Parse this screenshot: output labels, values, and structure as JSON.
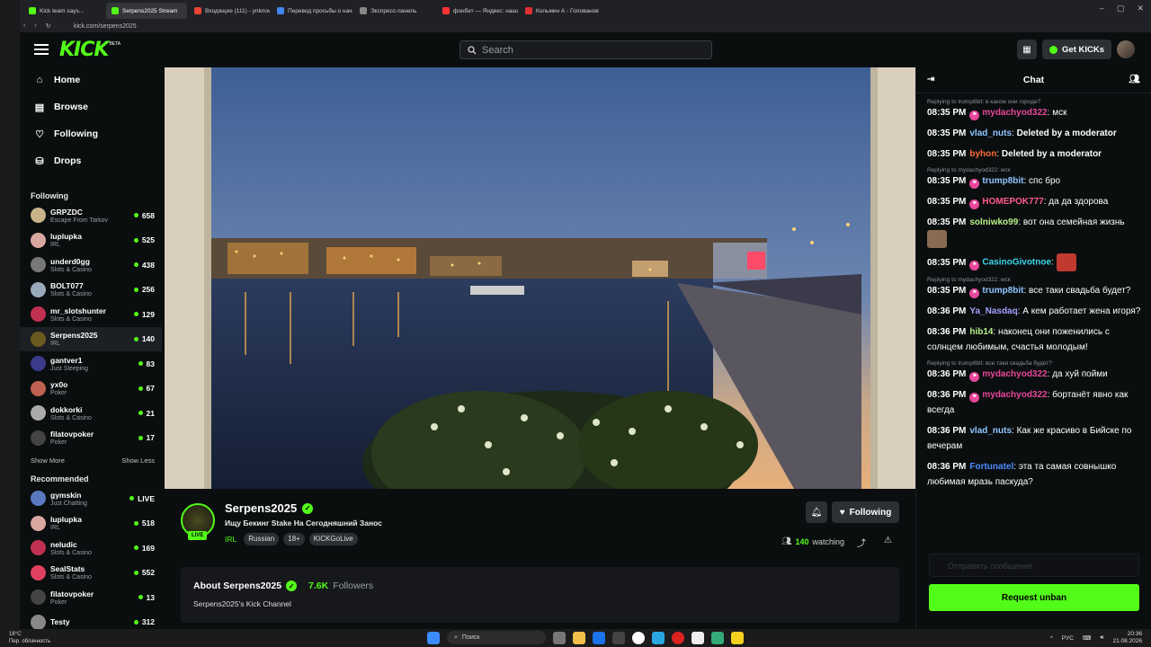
{
  "browser": {
    "tabs": [
      {
        "label": "Kick team says...",
        "color": "#53fc18",
        "active": false
      },
      {
        "label": "Serpens2025 Stream",
        "color": "#53fc18",
        "active": true
      },
      {
        "label": "Входящие (111) - уnknown",
        "color": "#ea4335",
        "active": false
      },
      {
        "label": "Перевод просьбы о нача",
        "color": "#4285f4",
        "active": false
      },
      {
        "label": "Экспресс-панель",
        "color": "#888888",
        "active": false
      },
      {
        "label": "фонбет — Яндекс: нашло",
        "color": "#ff3333",
        "active": false
      },
      {
        "label": "Кольмин А - Голованов Г",
        "color": "#e03030",
        "active": false
      }
    ],
    "url": "kick.com/serpens2025"
  },
  "header": {
    "logo": "KICK",
    "logo_badge": "BETA",
    "search_placeholder": "Search",
    "get_kicks": "Get KICKs"
  },
  "sidebar": {
    "nav": [
      {
        "label": "Home",
        "icon": "home-icon",
        "glyph": "⌂"
      },
      {
        "label": "Browse",
        "icon": "browse-icon",
        "glyph": "▤"
      },
      {
        "label": "Following",
        "icon": "heart-icon",
        "glyph": "♡"
      },
      {
        "label": "Drops",
        "icon": "drops-icon",
        "glyph": "⛁"
      }
    ],
    "following_title": "Following",
    "following": [
      {
        "name": "GRPZDC",
        "cat": "Escape From Tarkov",
        "viewers": "658",
        "color": "#c9b48a"
      },
      {
        "name": "luplupka",
        "cat": "IRL",
        "viewers": "525",
        "color": "#d8a8a0"
      },
      {
        "name": "underd0gg",
        "cat": "Slots & Casino",
        "viewers": "438",
        "color": "#777"
      },
      {
        "name": "BOLT077",
        "cat": "Slots & Casino",
        "viewers": "256",
        "color": "#9ab"
      },
      {
        "name": "mr_slotshunter",
        "cat": "Slots & Casino",
        "viewers": "129",
        "color": "#c03050"
      },
      {
        "name": "Serpens2025",
        "cat": "IRL",
        "viewers": "140",
        "color": "#6a5a20"
      },
      {
        "name": "gantver1",
        "cat": "Just Sleeping",
        "viewers": "83",
        "color": "#3a3a8a"
      },
      {
        "name": "yx0o",
        "cat": "Poker",
        "viewers": "67",
        "color": "#c06050"
      },
      {
        "name": "dokkorki",
        "cat": "Slots & Casino",
        "viewers": "21",
        "color": "#aaa"
      },
      {
        "name": "filatovpoker",
        "cat": "Poker",
        "viewers": "17",
        "color": "#444"
      }
    ],
    "show_more": "Show More",
    "show_less": "Show Less",
    "recommended_title": "Recommended",
    "recommended": [
      {
        "name": "gymskin",
        "cat": "Just Chatting",
        "viewers": "LIVE",
        "color": "#5a7ac0"
      },
      {
        "name": "luplupka",
        "cat": "IRL",
        "viewers": "518",
        "color": "#d8a8a0"
      },
      {
        "name": "neludic",
        "cat": "Slots & Casino",
        "viewers": "169",
        "color": "#c03050"
      },
      {
        "name": "SealStats",
        "cat": "Slots & Casino",
        "viewers": "552",
        "color": "#e04060"
      },
      {
        "name": "filatovpoker",
        "cat": "Poker",
        "viewers": "13",
        "color": "#444"
      },
      {
        "name": "Testy",
        "cat": "",
        "viewers": "312",
        "color": "#888"
      }
    ]
  },
  "stream": {
    "name": "Serpens2025",
    "live": "LIVE",
    "title": "Ищу Бекинг Stake На Сегодняшний Занос",
    "category": "IRL",
    "tags": [
      "Russian",
      "18+",
      "KICKGoLive"
    ],
    "viewers": "140",
    "watching_label": "watching",
    "follow_label": "Following",
    "about_title": "About Serpens2025",
    "followers_count": "7.6K",
    "followers_label": "Followers",
    "about_desc": "Serpens2025's Kick Channel"
  },
  "chat": {
    "title": "Chat",
    "messages": [
      {
        "reply": "Replying to trump8bit: в каком они городе?",
        "time": "08:35 PM",
        "badge": true,
        "user": "mydachyod322",
        "color": "#e8479b",
        "text": "мск"
      },
      {
        "reply": "",
        "time": "08:35 PM",
        "badge": false,
        "user": "vlad_nuts",
        "color": "#8ec5ff",
        "text": "Deleted by a moderator",
        "bold": true
      },
      {
        "reply": "",
        "time": "08:35 PM",
        "badge": false,
        "user": "byhon",
        "color": "#ff6b35",
        "text": "Deleted by a moderator",
        "bold": true
      },
      {
        "reply": "Replying to mydachyod322: мск",
        "time": "08:35 PM",
        "badge": true,
        "user": "trump8bit",
        "color": "#8ec5ff",
        "text": "спс бро"
      },
      {
        "reply": "",
        "time": "08:35 PM",
        "badge": true,
        "user": "HOMEPOK777",
        "color": "#ff5a8a",
        "text": "да да здорова"
      },
      {
        "reply": "",
        "time": "08:35 PM",
        "badge": false,
        "user": "solniwko99",
        "color": "#b6f08a",
        "text": "вот она семейная жизнь",
        "emote": "#8a6a50"
      },
      {
        "reply": "",
        "time": "08:35 PM",
        "badge": true,
        "user": "CasinoGivotnoe",
        "color": "#3ad6e8",
        "text": "",
        "emote": "#c03a30"
      },
      {
        "reply": "Replying to mydachyod322: мск",
        "time": "08:35 PM",
        "badge": true,
        "user": "trump8bit",
        "color": "#8ec5ff",
        "text": "все таки свадьба будет?"
      },
      {
        "reply": "",
        "time": "08:36 PM",
        "badge": false,
        "user": "Ya_Nasdaq",
        "color": "#a0a0ff",
        "text": "А кем работает жена игоря?"
      },
      {
        "reply": "",
        "time": "08:36 PM",
        "badge": false,
        "user": "hib14",
        "color": "#b6f08a",
        "text": "наконец они поженились с солнцем любимым, счастья молодым!"
      },
      {
        "reply": "Replying to trump8bit: все таки свадьба будет?",
        "time": "08:36 PM",
        "badge": true,
        "user": "mydachyod322",
        "color": "#e8479b",
        "text": "да хуй пойми"
      },
      {
        "reply": "",
        "time": "08:36 PM",
        "badge": true,
        "user": "mydachyod322",
        "color": "#e8479b",
        "text": "бортанёт явно как всегда"
      },
      {
        "reply": "",
        "time": "08:36 PM",
        "badge": false,
        "user": "vlad_nuts",
        "color": "#8ec5ff",
        "text": "Как же красиво в Бийске по вечерам"
      },
      {
        "reply": "",
        "time": "08:36 PM",
        "badge": false,
        "user": "Fortunatel",
        "color": "#4a8cff",
        "text": "эта та самая совнышко любимая мразь паскуда?"
      }
    ],
    "input_placeholder": "Отправить сообщение",
    "unban_label": "Request unban"
  },
  "taskbar": {
    "weather_temp": "18°C",
    "weather_desc": "Пер. облачность",
    "search": "Поиск",
    "lang": "РУС",
    "time": "20:36",
    "date": "21.08.2026"
  },
  "colors": {
    "accent": "#53fc18",
    "bg": "#0b0e0f",
    "surface": "#16181c"
  }
}
